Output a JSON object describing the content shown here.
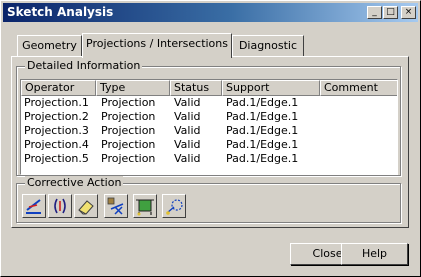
{
  "window": {
    "title": "Sketch Analysis"
  },
  "titlebar_buttons": {
    "minimize": "_",
    "maximize": "□",
    "close": "×"
  },
  "tabs": [
    {
      "label": "Geometry",
      "active": false
    },
    {
      "label": "Projections / Intersections",
      "active": true
    },
    {
      "label": "Diagnostic",
      "active": false
    }
  ],
  "detailed_info": {
    "legend": "Detailed Information",
    "columns": [
      "Operator",
      "Type",
      "Status",
      "Support",
      "Comment"
    ],
    "rows": [
      [
        "Projection.1",
        "Projection",
        "Valid",
        "Pad.1/Edge.1",
        ""
      ],
      [
        "Projection.2",
        "Projection",
        "Valid",
        "Pad.1/Edge.1",
        ""
      ],
      [
        "Projection.3",
        "Projection",
        "Valid",
        "Pad.1/Edge.1",
        ""
      ],
      [
        "Projection.4",
        "Projection",
        "Valid",
        "Pad.1/Edge.1",
        ""
      ],
      [
        "Projection.5",
        "Projection",
        "Valid",
        "Pad.1/Edge.1",
        ""
      ]
    ]
  },
  "corrective_action": {
    "legend": "Corrective Action",
    "icons": [
      "isolate-icon",
      "construction-toggle-icon",
      "erase-icon",
      "isolate-projection-icon",
      "fix-together-icon",
      "deactivate-icon"
    ]
  },
  "footer": {
    "close_label": "Close",
    "help_label": "Help"
  }
}
